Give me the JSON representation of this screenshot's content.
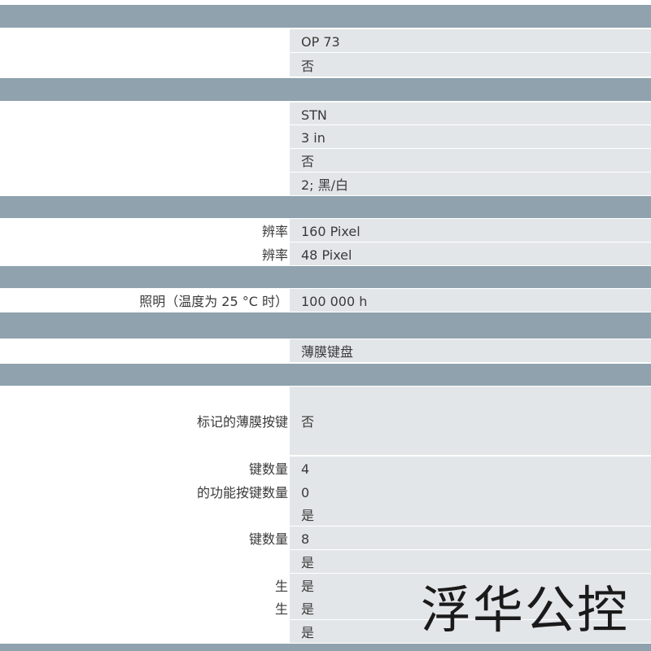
{
  "rows": [
    {
      "type": "section"
    },
    {
      "type": "data",
      "label": "",
      "value": "OP 73"
    },
    {
      "type": "data",
      "label": "",
      "value": "否"
    },
    {
      "type": "section"
    },
    {
      "type": "data",
      "label": "",
      "value": "STN"
    },
    {
      "type": "data",
      "label": "",
      "value": "3 in"
    },
    {
      "type": "data",
      "label": "",
      "value": "否"
    },
    {
      "type": "data",
      "label": "",
      "value": "2; 黑/白"
    },
    {
      "type": "section"
    },
    {
      "type": "data",
      "label": "辨率",
      "value": "160 Pixel"
    },
    {
      "type": "data",
      "label": "辨率",
      "value": "48 Pixel"
    },
    {
      "type": "section"
    },
    {
      "type": "data",
      "label": "照明（温度为 25 °C 时）",
      "value": "100 000 h"
    },
    {
      "type": "section"
    },
    {
      "type": "data",
      "label": "",
      "value": "薄膜键盘"
    },
    {
      "type": "section"
    },
    {
      "type": "data",
      "label": "标记的薄膜按键",
      "value": "否"
    },
    {
      "type": "data",
      "label": "键数量",
      "value": "4"
    },
    {
      "type": "data",
      "label": "的功能按键数量",
      "value": "0"
    },
    {
      "type": "data",
      "label": "",
      "value": "是"
    },
    {
      "type": "data",
      "label": "键数量",
      "value": "8"
    },
    {
      "type": "data",
      "label": "",
      "value": "是"
    },
    {
      "type": "data",
      "label": "生",
      "value": "是"
    },
    {
      "type": "data",
      "label": "生",
      "value": "是"
    },
    {
      "type": "data",
      "label": "",
      "value": "是"
    },
    {
      "type": "section"
    }
  ],
  "watermark": "浮华公控"
}
